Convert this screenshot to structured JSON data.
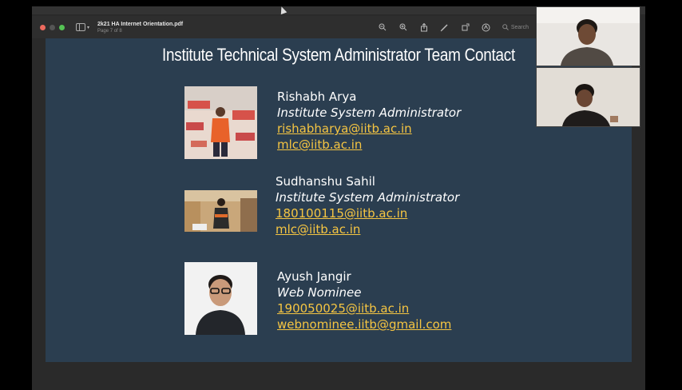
{
  "window": {
    "doc_name": "2k21 HA Internet Orientation.pdf",
    "page_indicator": "Page 7 of 8",
    "search_placeholder": "Search"
  },
  "slide": {
    "title": "Institute Technical System Administrator Team Contact",
    "contacts": [
      {
        "name": "Rishabh Arya",
        "role": "Institute System Administrator",
        "emails": [
          "rishabharya@iitb.ac.in",
          "mlc@iitb.ac.in"
        ]
      },
      {
        "name": "Sudhanshu Sahil",
        "role": "Institute System Administrator",
        "emails": [
          "180100115@iitb.ac.in",
          "mlc@iitb.ac.in"
        ]
      },
      {
        "name": "Ayush Jangir",
        "role": "Web Nominee",
        "emails": [
          "190050025@iitb.ac.in",
          "webnominee.iitb@gmail.com"
        ]
      }
    ]
  },
  "colors": {
    "slide_bg": "#2b3e50",
    "link": "#f5c542"
  }
}
